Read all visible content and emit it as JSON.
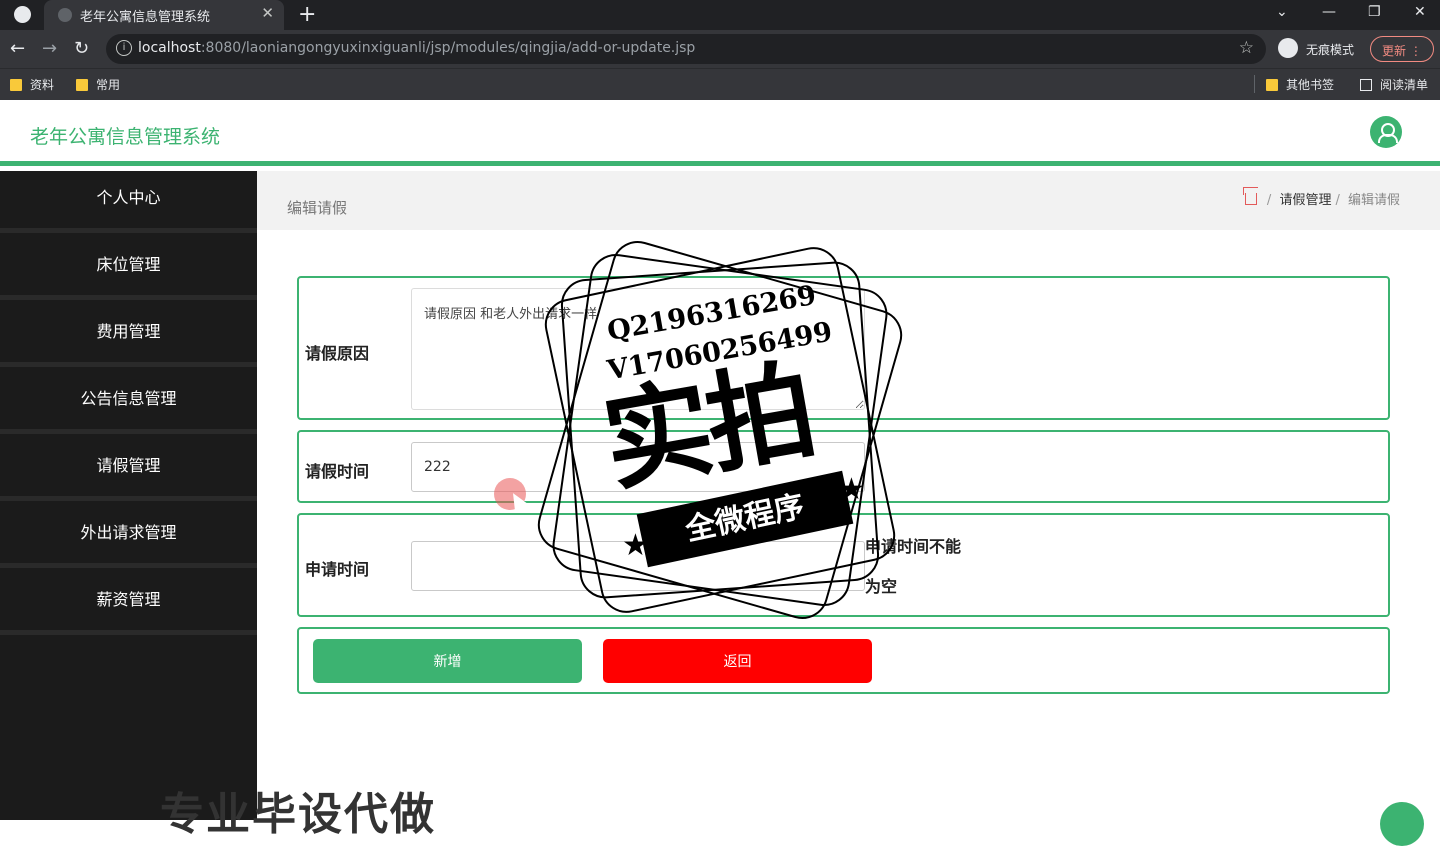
{
  "browser": {
    "tab_title": "老年公寓信息管理系统",
    "tab_close": "✕",
    "new_tab": "+",
    "url_host": "localhost",
    "url_rest": ":8080/laoniangongyuxinxiguanli/jsp/modules/qingjia/add-or-update.jsp",
    "incognito_label": "无痕模式",
    "update_label": "更新",
    "bookmarks": [
      "资料",
      "常用"
    ],
    "bookmarks_right": [
      "其他书签",
      "阅读清单"
    ]
  },
  "app": {
    "title": "老年公寓信息管理系统"
  },
  "sidebar": {
    "items": [
      {
        "label": "个人中心"
      },
      {
        "label": "床位管理"
      },
      {
        "label": "费用管理"
      },
      {
        "label": "公告信息管理"
      },
      {
        "label": "请假管理"
      },
      {
        "label": "外出请求管理"
      },
      {
        "label": "薪资管理"
      }
    ]
  },
  "page": {
    "heading": "编辑请假",
    "breadcrumb": [
      "请假管理",
      "编辑请假"
    ]
  },
  "form": {
    "reason_label": "请假原因",
    "reason_value": "请假原因 和老人外出请求一样",
    "time_label": "请假时间",
    "time_value": "222",
    "apply_label": "申请时间",
    "apply_value": "",
    "apply_error_1": "申请时间不能",
    "apply_error_2": "为空",
    "add_button": "新增",
    "back_button": "返回"
  },
  "colors": {
    "accent": "#3cb371",
    "danger": "#ff0000",
    "sidebar_bg": "#1b1b1b"
  },
  "watermark": {
    "line1": "Q2196316269",
    "line2": "V17060256499",
    "big": "实拍",
    "ribbon": "全微程序",
    "bottom": "专业毕设代做"
  }
}
